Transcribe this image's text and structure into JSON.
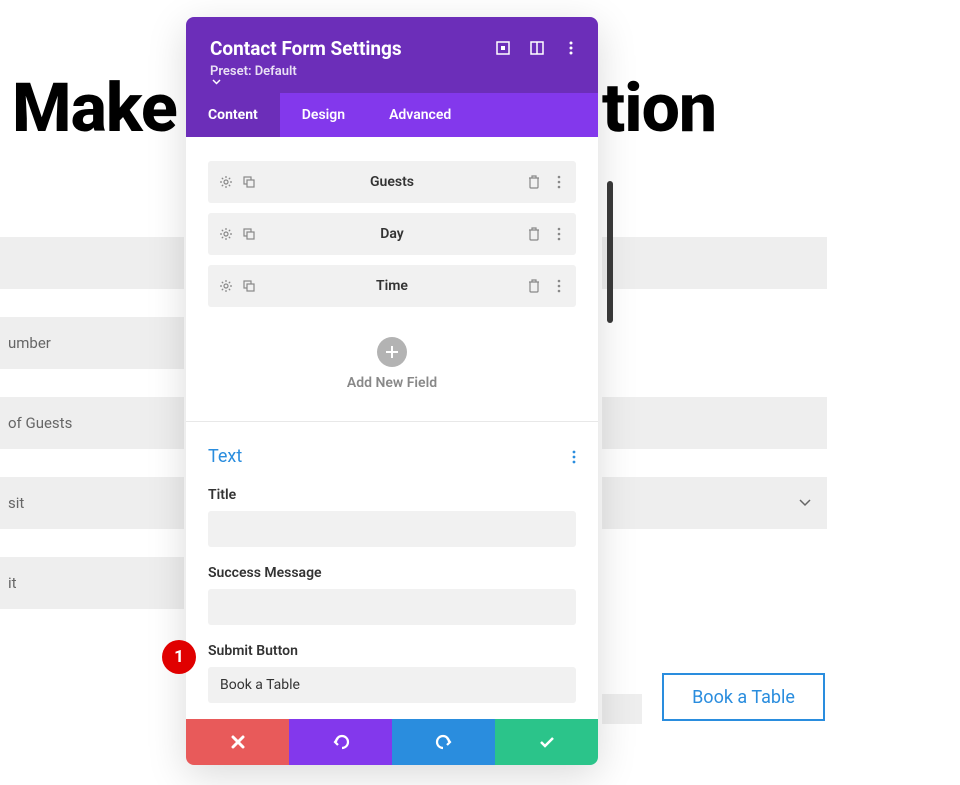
{
  "background": {
    "heading_left": "Make",
    "heading_right": "tion",
    "fields": {
      "phone": "umber",
      "guests": "of Guests",
      "day": "sit",
      "time": "it"
    },
    "button": "Book a Table"
  },
  "modal": {
    "title": "Contact Form Settings",
    "preset_label": "Preset: Default",
    "tabs": {
      "content": "Content",
      "design": "Design",
      "advanced": "Advanced"
    },
    "fields": [
      {
        "label": "Guests"
      },
      {
        "label": "Day"
      },
      {
        "label": "Time"
      }
    ],
    "add_field_label": "Add New Field",
    "text_section": {
      "heading": "Text",
      "title_label": "Title",
      "title_value": "",
      "success_label": "Success Message",
      "success_value": "",
      "submit_label": "Submit Button",
      "submit_value": "Book a Table"
    }
  },
  "annotation": {
    "number": "1"
  }
}
